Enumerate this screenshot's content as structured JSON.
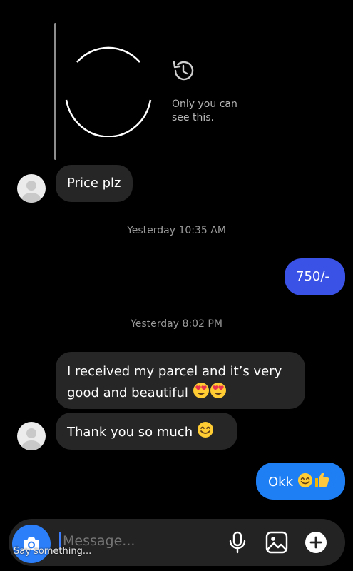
{
  "story": {
    "note": "Only you can see this.",
    "history_icon": "history-icon"
  },
  "messages": [
    {
      "side": "in",
      "text": "Price plz"
    },
    {
      "side": "out",
      "text": "750/-"
    },
    {
      "side": "in",
      "text_line1": "I received my parcel and it’s very",
      "text_line2": "good and beautiful"
    },
    {
      "side": "in",
      "text": "Thank you so much"
    },
    {
      "side": "out",
      "text": "Okk"
    }
  ],
  "timestamps": [
    "Yesterday 10:35 AM",
    "Yesterday 8:02 PM"
  ],
  "composer": {
    "placeholder": "Message...",
    "overlay_text": "Say something...",
    "icons": [
      "camera-icon",
      "microphone-icon",
      "image-icon",
      "plus-icon"
    ]
  },
  "colors": {
    "outgoing_purple": "#3a52e6",
    "outgoing_blue": "#1e7ff5",
    "incoming": "#262626",
    "camera_button": "#2d7ff9"
  }
}
